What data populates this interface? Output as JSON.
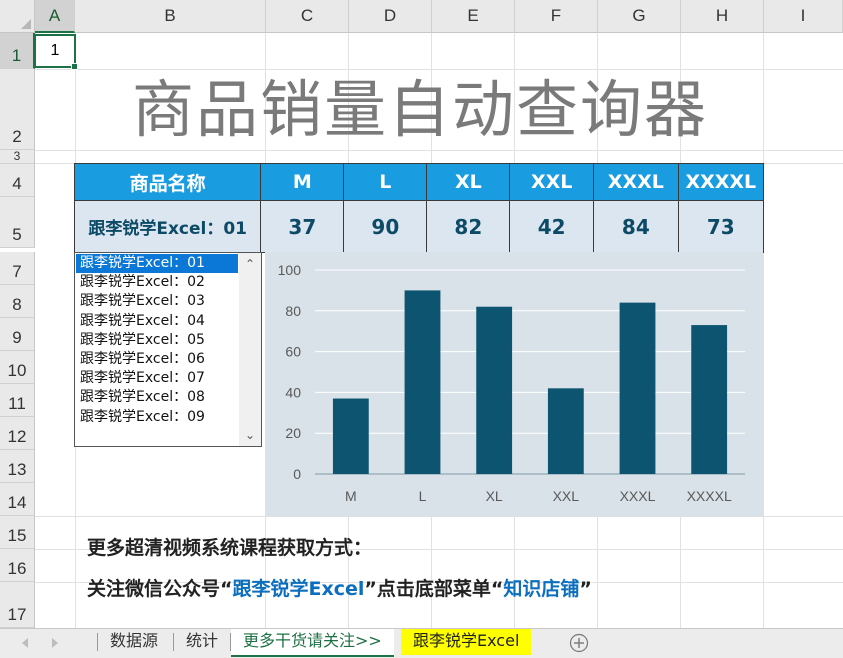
{
  "sheet": {
    "columns": [
      "A",
      "B",
      "C",
      "D",
      "E",
      "F",
      "G",
      "H",
      "I"
    ],
    "rows": [
      "1",
      "2",
      "3",
      "4",
      "5",
      "7",
      "8",
      "9",
      "10",
      "11",
      "12",
      "13",
      "14",
      "15",
      "16",
      "17"
    ],
    "active_cell_value": "1"
  },
  "title": "商品销量自动查询器",
  "table": {
    "headers": [
      "商品名称",
      "M",
      "L",
      "XL",
      "XXL",
      "XXXL",
      "XXXXL"
    ],
    "row": [
      "跟李锐学Excel：01",
      "37",
      "90",
      "82",
      "42",
      "84",
      "73"
    ]
  },
  "listbox": {
    "items": [
      "跟李锐学Excel：01",
      "跟李锐学Excel：02",
      "跟李锐学Excel：03",
      "跟李锐学Excel：04",
      "跟李锐学Excel：05",
      "跟李锐学Excel：06",
      "跟李锐学Excel：07",
      "跟李锐学Excel：08",
      "跟李锐学Excel：09"
    ],
    "selected_index": 0
  },
  "chart_data": {
    "type": "bar",
    "categories": [
      "M",
      "L",
      "XL",
      "XXL",
      "XXXL",
      "XXXXL"
    ],
    "values": [
      37,
      90,
      82,
      42,
      84,
      73
    ],
    "ylim": [
      0,
      100
    ],
    "yticks": [
      "0",
      "20",
      "40",
      "60",
      "80",
      "100"
    ],
    "grid": true,
    "bar_color": "#0d5470",
    "background": "#d9e2e8"
  },
  "footer": {
    "line1": "更多超清视频系统课程获取方式：",
    "line2_a": "关注微信公众号“",
    "line2_b": "跟李锐学Excel",
    "line2_c": "”点击底部菜单“",
    "line2_d": "知识店铺",
    "line2_e": "”"
  },
  "tabs": {
    "items": [
      "数据源",
      "统计",
      "更多干货请关注>>",
      "跟李锐学Excel"
    ],
    "add_icon": "plus-circle-icon",
    "nav_prev_icon": "triangle-left-icon",
    "nav_next_icon": "triangle-right-icon"
  }
}
